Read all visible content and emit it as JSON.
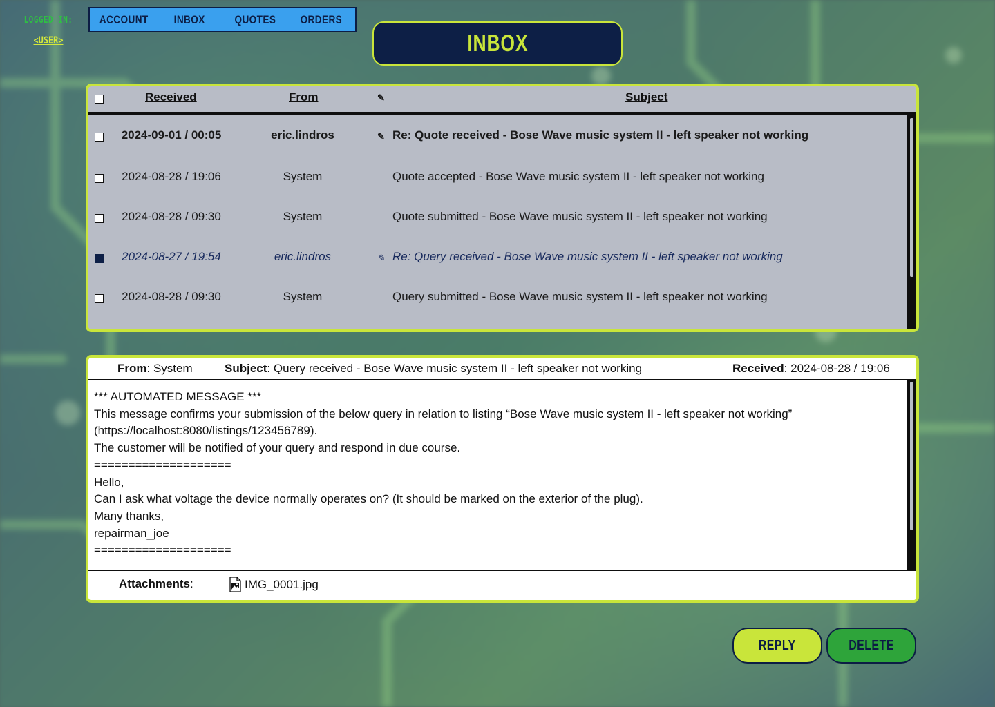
{
  "user_panel": {
    "logged_in_label": "LOGGED IN:",
    "username": "<USER>"
  },
  "nav": {
    "tabs": [
      {
        "label": "ACCOUNT"
      },
      {
        "label": "INBOX"
      },
      {
        "label": "QUOTES"
      },
      {
        "label": "ORDERS"
      }
    ]
  },
  "page_title": "INBOX",
  "inbox": {
    "columns": {
      "received": "Received",
      "from": "From",
      "attachment_icon": "paperclip-icon",
      "subject": "Subject"
    },
    "rows": [
      {
        "received": "2024-09-01 / 00:05",
        "from": "eric.lindros",
        "has_attachment": true,
        "attachment_glyph": "✎",
        "subject": "Re: Quote received - Bose Wave music system II - left speaker not working",
        "unread": true,
        "checked": false
      },
      {
        "received": "2024-08-28 / 19:06",
        "from": "System",
        "has_attachment": false,
        "attachment_glyph": "",
        "subject": "Quote accepted - Bose Wave music system II - left speaker not working",
        "unread": false,
        "checked": false
      },
      {
        "received": "2024-08-28 / 09:30",
        "from": "System",
        "has_attachment": false,
        "attachment_glyph": "",
        "subject": "Quote submitted - Bose Wave music system II - left speaker not working",
        "unread": false,
        "checked": false
      },
      {
        "received": "2024-08-27 / 19:54",
        "from": "eric.lindros",
        "has_attachment": true,
        "attachment_glyph": "✎",
        "subject": "Re: Query received - Bose Wave music system II - left speaker not working",
        "unread": false,
        "checked": true
      },
      {
        "received": "2024-08-28 / 09:30",
        "from": "System",
        "has_attachment": false,
        "attachment_glyph": "",
        "subject": "Query submitted - Bose Wave music system II - left speaker not working",
        "unread": false,
        "checked": false
      }
    ]
  },
  "message": {
    "from_label": "From",
    "from_value": ": System",
    "subject_label": "Subject",
    "subject_value": ": Query received - Bose Wave music system II - left speaker not working",
    "received_label": "Received",
    "received_value": ": 2024-08-28 / 19:06",
    "body_lines": [
      "*** AUTOMATED MESSAGE ***",
      "This message confirms your submission of the below query in relation to listing “Bose Wave music system II - left speaker not working”",
      "(https://localhost:8080/listings/123456789).",
      "The customer will be notified of your query and respond in due course.",
      "",
      "====================",
      "Hello,",
      "Can I ask what voltage the device normally operates on? (It should be marked on the exterior of the plug).",
      "Many thanks,",
      "repairman_joe",
      "===================="
    ],
    "attachments_label": "Attachments",
    "attachments_colon": ":",
    "attachment_file": "IMG_0001.jpg"
  },
  "actions": {
    "reply_label": "REPLY",
    "delete_label": "DELETE"
  },
  "colors": {
    "accent_lime": "#c9e53a",
    "navy": "#0d1f46",
    "nav_blue": "#3aa0ee",
    "delete_green": "#2ea43a",
    "login_green": "#2fbf44"
  }
}
